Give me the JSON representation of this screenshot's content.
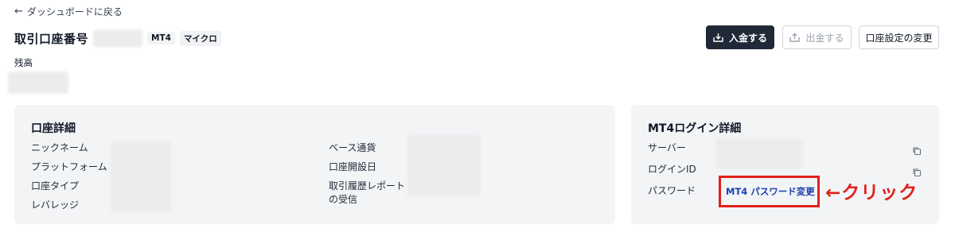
{
  "nav": {
    "back_label": "ダッシュボードに戻る"
  },
  "header": {
    "title": "取引口座番号",
    "badges": [
      "MT4",
      "マイクロ"
    ],
    "balance_label": "残高"
  },
  "actions": {
    "deposit": "入金する",
    "withdraw": "出金する",
    "settings": "口座設定の変更"
  },
  "account_details": {
    "title": "口座詳細",
    "left_fields": [
      "ニックネーム",
      "プラットフォーム",
      "口座タイプ",
      "レバレッジ"
    ],
    "right_fields": [
      "ベース通貨",
      "口座開設日",
      "取引履歴レポート",
      "の受信"
    ]
  },
  "mt4_login": {
    "title": "MT4ログイン詳細",
    "fields": [
      "サーバー",
      "ログインID",
      "パスワード"
    ],
    "password_link": "MT4 パスワード変更"
  },
  "annotation": {
    "click_note": "←クリック"
  },
  "colors": {
    "primary": "#1f2937",
    "link": "#1e40af",
    "highlight": "#e0211b",
    "card_bg": "#f3f4f6"
  }
}
